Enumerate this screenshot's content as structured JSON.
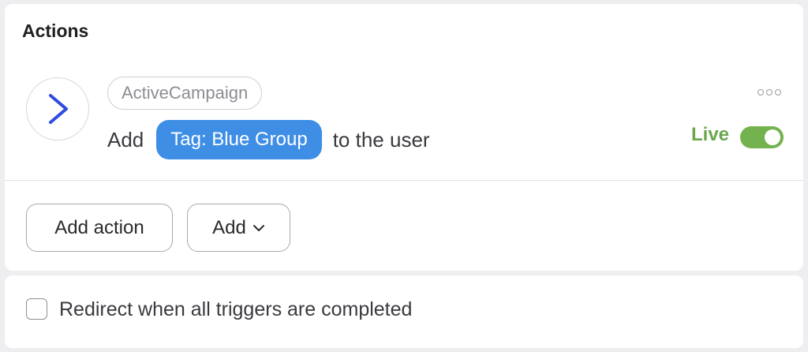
{
  "actions": {
    "title": "Actions",
    "item": {
      "provider": "ActiveCampaign",
      "sentence_prefix": "Add",
      "tag_label": "Tag: Blue Group",
      "sentence_suffix": "to the user",
      "status_label": "Live",
      "status_on": true,
      "icon": "activecampaign-chevron-icon",
      "icon_color": "#2f4ce0",
      "tag_color": "#3e8ee6",
      "status_color": "#6aa64b"
    },
    "buttons": {
      "add_action_label": "Add action",
      "add_label": "Add"
    }
  },
  "footer": {
    "redirect_label": "Redirect when all triggers are completed",
    "redirect_checked": false
  }
}
